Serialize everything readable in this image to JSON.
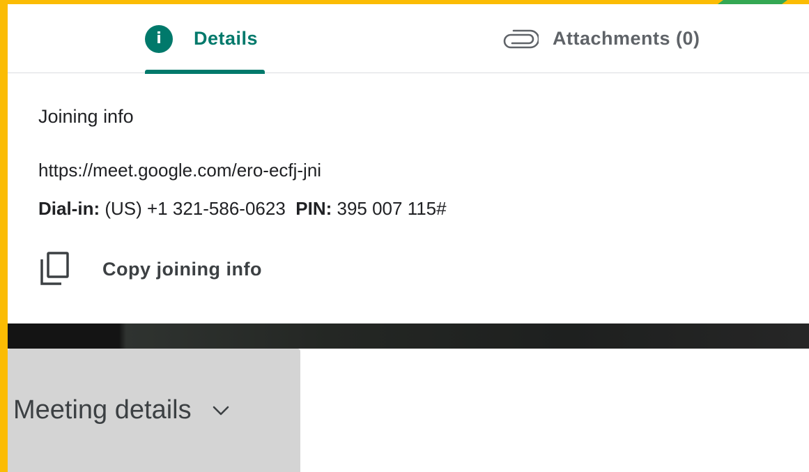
{
  "tabs": {
    "details": {
      "label": "Details",
      "icon": "info-icon",
      "active": true
    },
    "attachments": {
      "label": "Attachments (0)",
      "icon": "paperclip-icon"
    }
  },
  "joining_info": {
    "title": "Joining info",
    "link": "https://meet.google.com/ero-ecfj-jni",
    "dial_in_label": "Dial-in:",
    "dial_in_value": "(US) +1 321-586-0623",
    "pin_label": "PIN:",
    "pin_value": "395 007 115#",
    "copy_label": "Copy joining info",
    "copy_icon": "copy-icon"
  },
  "meeting_details": {
    "label": "Meeting details",
    "icon": "chevron-down-icon"
  },
  "colors": {
    "accent": "#00796b",
    "frame": "#fbbc04",
    "corner": "#34a853"
  }
}
